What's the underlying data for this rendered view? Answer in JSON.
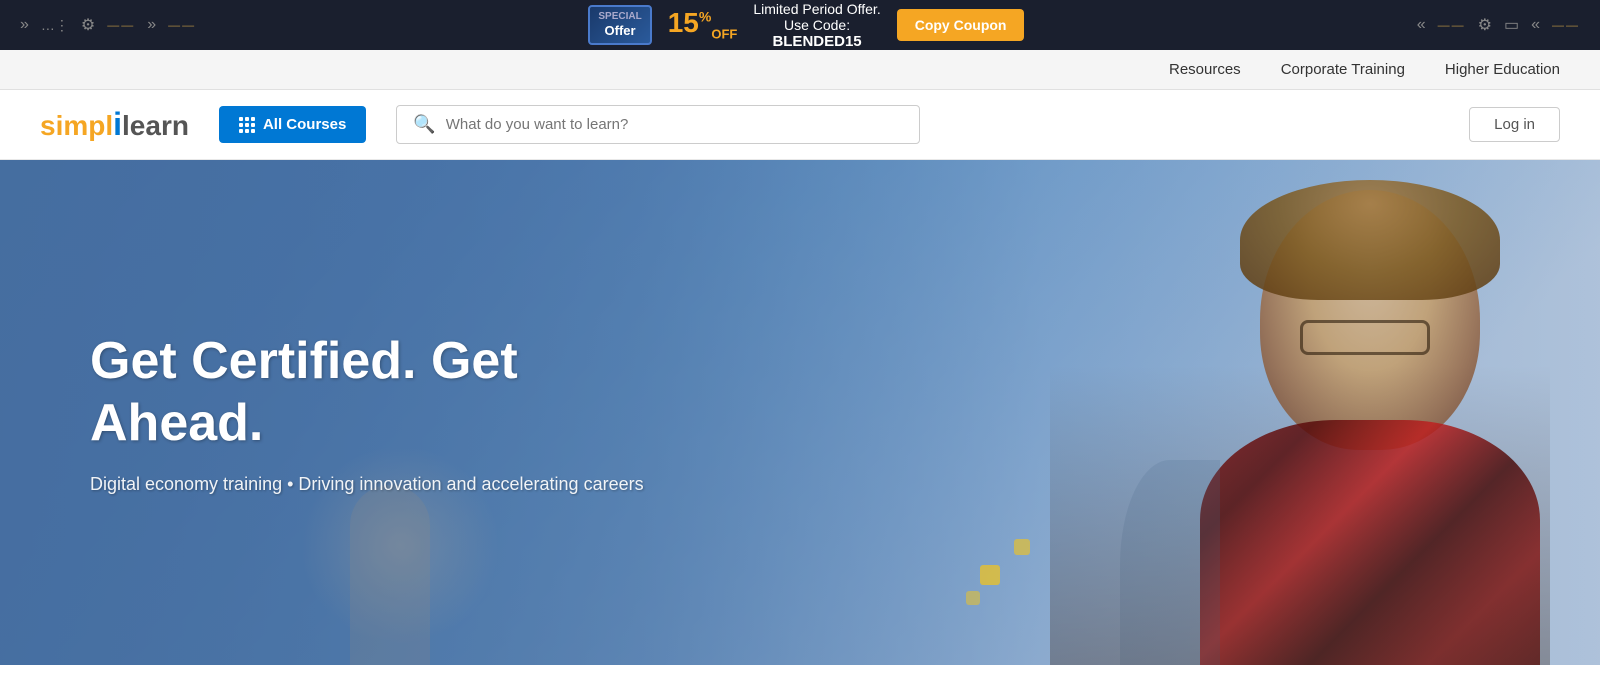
{
  "announcement": {
    "special_offer_line1": "SPECIAL",
    "special_offer_line2": "Offer",
    "discount_number": "15",
    "discount_suffix": "%",
    "discount_label": "OFF",
    "offer_text_line1": "Limited Period Offer.",
    "offer_text_line2": "Use Code:",
    "promo_code": "BLENDED15",
    "copy_coupon_label": "Copy Coupon"
  },
  "nav": {
    "resources_label": "Resources",
    "corporate_training_label": "Corporate Training",
    "higher_education_label": "Higher Education"
  },
  "header": {
    "logo_simpl": "simpl",
    "logo_i": "i",
    "logo_learn": "learn",
    "all_courses_label": "All Courses",
    "search_placeholder": "What do you want to learn?",
    "login_label": "Log in"
  },
  "hero": {
    "title": "Get Certified. Get Ahead.",
    "subtitle": "Digital economy training • Driving innovation and accelerating careers"
  }
}
